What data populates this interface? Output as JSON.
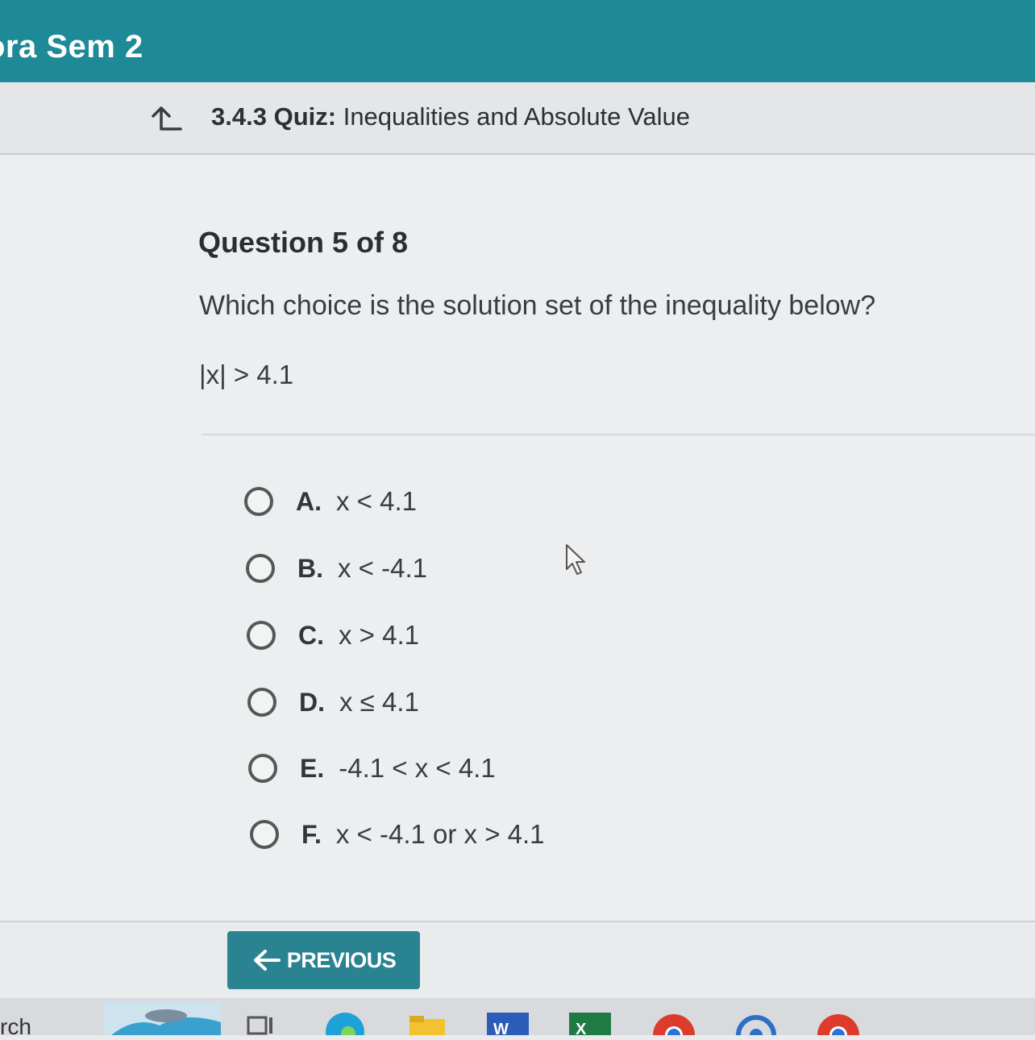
{
  "header": {
    "course_title": "ora Sem 2"
  },
  "breadcrumb": {
    "quiz_number": "3.4.3",
    "quiz_label": "Quiz:",
    "quiz_name": "Inequalities and Absolute Value"
  },
  "question": {
    "number_label": "Question 5 of 8",
    "prompt": "Which choice is the solution set of the inequality below?",
    "expression": "|x| > 4.1"
  },
  "choices": [
    {
      "letter": "A.",
      "text": "x < 4.1"
    },
    {
      "letter": "B.",
      "text": "x < -4.1"
    },
    {
      "letter": "C.",
      "text": "x > 4.1"
    },
    {
      "letter": "D.",
      "text": "x ≤ 4.1"
    },
    {
      "letter": "E.",
      "text": "-4.1 < x < 4.1"
    },
    {
      "letter": "F.",
      "text": "x < -4.1 or x > 4.1"
    }
  ],
  "navigation": {
    "previous_label": "PREVIOUS"
  },
  "taskbar": {
    "search_fragment": "rch",
    "apps": [
      "dolphin-widget-icon",
      "task-view-icon",
      "edge-icon",
      "file-explorer-icon",
      "word-icon",
      "excel-icon",
      "chrome-icon",
      "sync-icon",
      "chrome-icon"
    ]
  },
  "colors": {
    "header": "#1e8a97",
    "button": "#2a8391"
  }
}
